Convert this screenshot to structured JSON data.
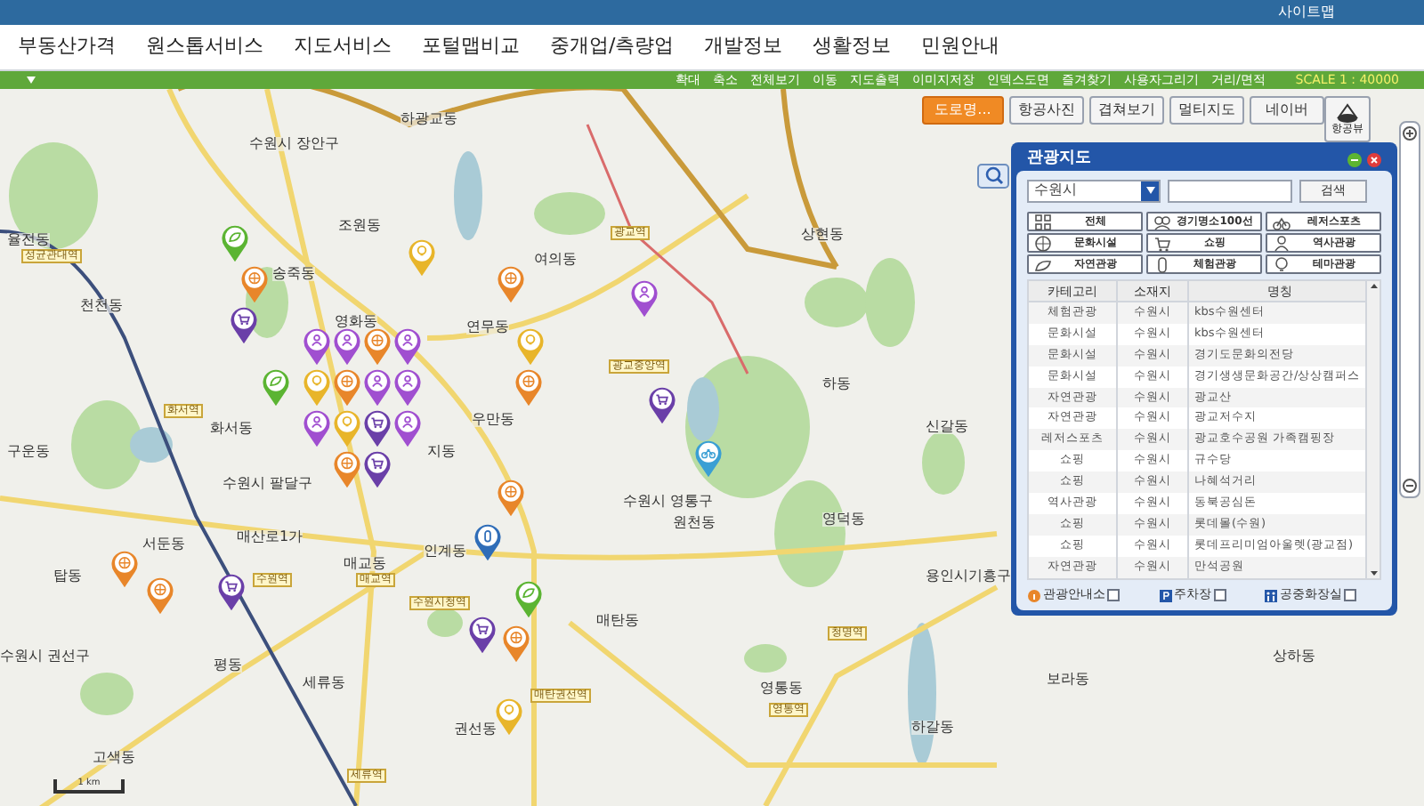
{
  "top_bar": {
    "links": [
      "사이트맵"
    ]
  },
  "menu": [
    "부동산가격",
    "원스톱서비스",
    "지도서비스",
    "포털맵비교",
    "중개업/측량업",
    "개발정보",
    "생활정보",
    "민원안내"
  ],
  "toolbar": {
    "items": [
      "확대",
      "축소",
      "전체보기",
      "이동",
      "지도출력",
      "이미지저장",
      "인덱스도면",
      "즐겨찾기",
      "사용자그리기",
      "거리/면적"
    ],
    "scale": "SCALE 1 : 40000"
  },
  "map_types": [
    {
      "label": "도로명...",
      "selected": true
    },
    {
      "label": "항공사진",
      "selected": false
    },
    {
      "label": "겹쳐보기",
      "selected": false
    },
    {
      "label": "멀티지도",
      "selected": false
    },
    {
      "label": "네이버",
      "selected": false
    }
  ],
  "aerial_view": {
    "label": "항공뷰"
  },
  "place_labels": [
    "하광교동",
    "수원시 장안구",
    "조원동",
    "율전동",
    "천천동",
    "송죽동",
    "연무동",
    "여의동",
    "상현동",
    "영화동",
    "화서동",
    "구운동",
    "우만동",
    "지동",
    "하동",
    "신갈동",
    "수원시 팔달구",
    "수원시 영통구",
    "원천동",
    "영덕동",
    "서둔동",
    "매산로1가",
    "인계동",
    "탑동",
    "매교동",
    "용인시기흥구",
    "매탄동",
    "수원시 권선구",
    "평동",
    "세류동",
    "영통동",
    "보라동",
    "상하동",
    "권선동",
    "하갈동",
    "고색동"
  ],
  "stations": [
    "성균관대역",
    "광교역",
    "광교중앙역",
    "화서역",
    "수원역",
    "매교역",
    "수원시청역",
    "매탄권선역",
    "세류역",
    "청명역",
    "영통역"
  ],
  "scale_bar": "1 km",
  "pins": [
    {
      "kind": "nature",
      "color": "#5bb432"
    },
    {
      "kind": "culture",
      "color": "#e8862a"
    },
    {
      "kind": "shopping",
      "color": "#6a3fa8"
    },
    {
      "kind": "theme",
      "color": "#e8b52a"
    },
    {
      "kind": "culture",
      "color": "#e8862a"
    },
    {
      "kind": "theme",
      "color": "#e8b52a"
    },
    {
      "kind": "culture",
      "color": "#e8862a"
    },
    {
      "kind": "history",
      "color": "#a04fd0"
    },
    {
      "kind": "shopping",
      "color": "#6a3fa8"
    },
    {
      "kind": "leisure",
      "color": "#3a9fd4"
    },
    {
      "kind": "nature",
      "color": "#5bb432"
    },
    {
      "kind": "history",
      "color": "#a04fd0"
    },
    {
      "kind": "history",
      "color": "#a04fd0"
    },
    {
      "kind": "culture",
      "color": "#e8862a"
    },
    {
      "kind": "history",
      "color": "#a04fd0"
    },
    {
      "kind": "theme",
      "color": "#e8b52a"
    },
    {
      "kind": "culture",
      "color": "#e8862a"
    },
    {
      "kind": "history",
      "color": "#a04fd0"
    },
    {
      "kind": "history",
      "color": "#a04fd0"
    },
    {
      "kind": "history",
      "color": "#a04fd0"
    },
    {
      "kind": "theme",
      "color": "#e8b52a"
    },
    {
      "kind": "shopping",
      "color": "#6a3fa8"
    },
    {
      "kind": "history",
      "color": "#a04fd0"
    },
    {
      "kind": "culture",
      "color": "#e8862a"
    },
    {
      "kind": "shopping",
      "color": "#6a3fa8"
    },
    {
      "kind": "culture",
      "color": "#e8862a"
    },
    {
      "kind": "experience",
      "color": "#2f6db8"
    },
    {
      "kind": "nature",
      "color": "#5bb432"
    },
    {
      "kind": "shopping",
      "color": "#6a3fa8"
    },
    {
      "kind": "culture",
      "color": "#e8862a"
    },
    {
      "kind": "theme",
      "color": "#e8b52a"
    },
    {
      "kind": "culture",
      "color": "#e8862a"
    },
    {
      "kind": "culture",
      "color": "#e8862a"
    },
    {
      "kind": "shopping",
      "color": "#6a3fa8"
    }
  ],
  "panel": {
    "title": "관광지도",
    "region": "수원시",
    "search_button": "검색",
    "categories": [
      {
        "kind": "grid",
        "label": "전체"
      },
      {
        "kind": "people",
        "label": "경기명소100선"
      },
      {
        "kind": "leisure",
        "label": "레저스포츠"
      },
      {
        "kind": "culture",
        "label": "문화시설"
      },
      {
        "kind": "shopping",
        "label": "쇼핑"
      },
      {
        "kind": "history",
        "label": "역사관광"
      },
      {
        "kind": "nature",
        "label": "자연관광"
      },
      {
        "kind": "experience",
        "label": "체험관광"
      },
      {
        "kind": "theme",
        "label": "테마관광"
      }
    ],
    "columns": [
      "카테고리",
      "소재지",
      "명칭"
    ],
    "rows": [
      [
        "체험관광",
        "수원시",
        "kbs수원센터"
      ],
      [
        "문화시설",
        "수원시",
        "kbs수원센터"
      ],
      [
        "문화시설",
        "수원시",
        "경기도문화의전당"
      ],
      [
        "문화시설",
        "수원시",
        "경기생생문화공간/상상캠퍼스"
      ],
      [
        "자연관광",
        "수원시",
        "광교산"
      ],
      [
        "자연관광",
        "수원시",
        "광교저수지"
      ],
      [
        "레저스포츠",
        "수원시",
        "광교호수공원 가족캠핑장"
      ],
      [
        "쇼핑",
        "수원시",
        "규수당"
      ],
      [
        "쇼핑",
        "수원시",
        "나혜석거리"
      ],
      [
        "역사관광",
        "수원시",
        "동북공심돈"
      ],
      [
        "쇼핑",
        "수원시",
        "롯데몰(수원)"
      ],
      [
        "쇼핑",
        "수원시",
        "롯데프리미엄아울렛(광교점)"
      ],
      [
        "자연관광",
        "수원시",
        "만석공원"
      ]
    ],
    "filters": [
      {
        "kind": "info",
        "label": "관광안내소",
        "checked": false
      },
      {
        "kind": "parking",
        "label": "주차장",
        "checked": false
      },
      {
        "kind": "toilet",
        "label": "공중화장실",
        "checked": false
      }
    ]
  }
}
